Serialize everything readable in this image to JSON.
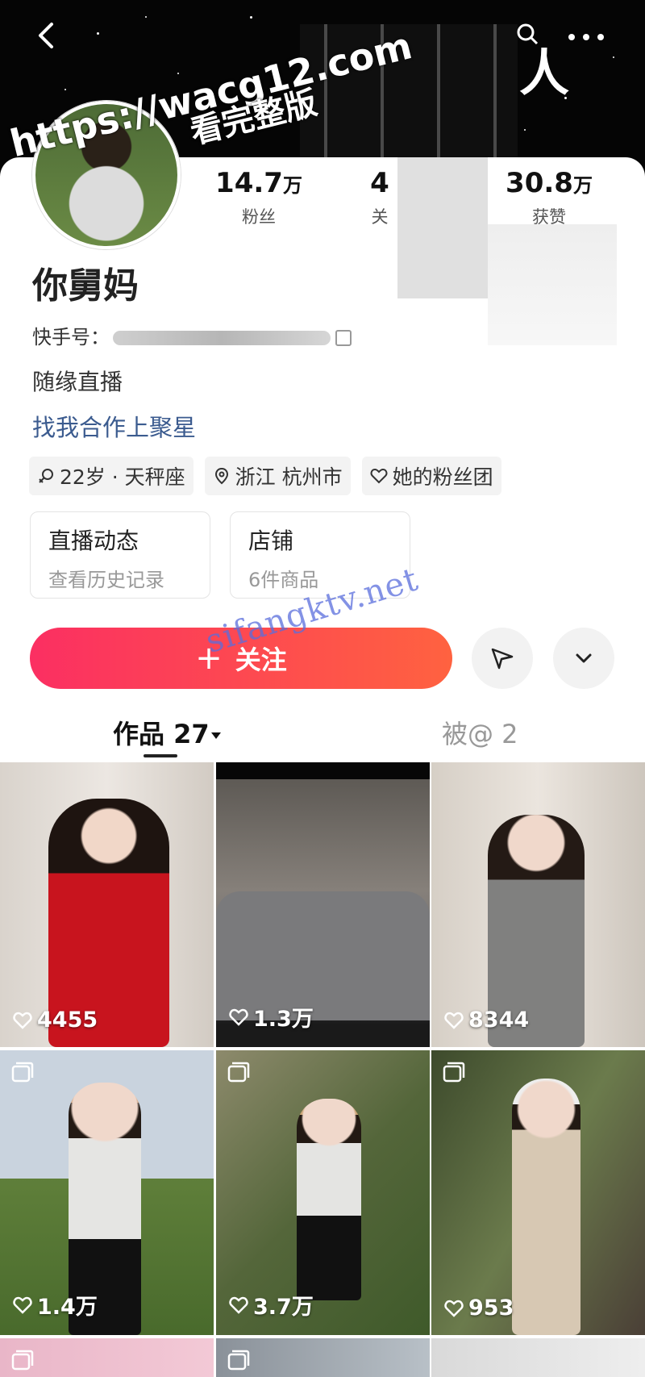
{
  "watermarks": {
    "url": "https://wacg12.com",
    "text": "看完整版",
    "site": "sifangktv.net"
  },
  "header": {
    "cover_char": "人",
    "icons": [
      "back-icon",
      "search-icon",
      "more-icon"
    ]
  },
  "profile": {
    "name": "你舅妈",
    "kuaishou_id_label": "快手号：",
    "bio": "随缘直播",
    "collab_link": "找我合作上聚星",
    "stats": [
      {
        "num": "14.7",
        "unit": "万",
        "label": "粉丝"
      },
      {
        "num": "4",
        "unit": "",
        "label": "关"
      },
      {
        "num": "30.8",
        "unit": "万",
        "label": "获赞"
      }
    ],
    "tags": [
      {
        "icon": "gender-female-icon",
        "text": "22岁 · 天秤座"
      },
      {
        "icon": "location-pin-icon",
        "text": "浙江 杭州市"
      },
      {
        "icon": "heart-outline-icon",
        "text": "她的粉丝团"
      }
    ],
    "tiles": [
      {
        "title": "直播动态",
        "subtitle": "查看历史记录"
      },
      {
        "title": "店铺",
        "subtitle": "6件商品"
      }
    ]
  },
  "actions": {
    "follow_plus": "+",
    "follow_label": "关注",
    "share_icon": "paper-plane-icon",
    "expand_icon": "chevron-down-icon"
  },
  "tabs": {
    "works": "作品 27",
    "mentions": "被@ 2"
  },
  "grid": [
    {
      "likes": "4455",
      "type": "video"
    },
    {
      "likes": "1.3万",
      "type": "video"
    },
    {
      "likes": "8344",
      "type": "video"
    },
    {
      "likes": "1.4万",
      "type": "photo"
    },
    {
      "likes": "3.7万",
      "type": "photo"
    },
    {
      "likes": "953",
      "type": "photo"
    }
  ],
  "colors": {
    "follow_start": "#fb2f62",
    "follow_end": "#ff6240",
    "link": "#3b5b8f"
  }
}
